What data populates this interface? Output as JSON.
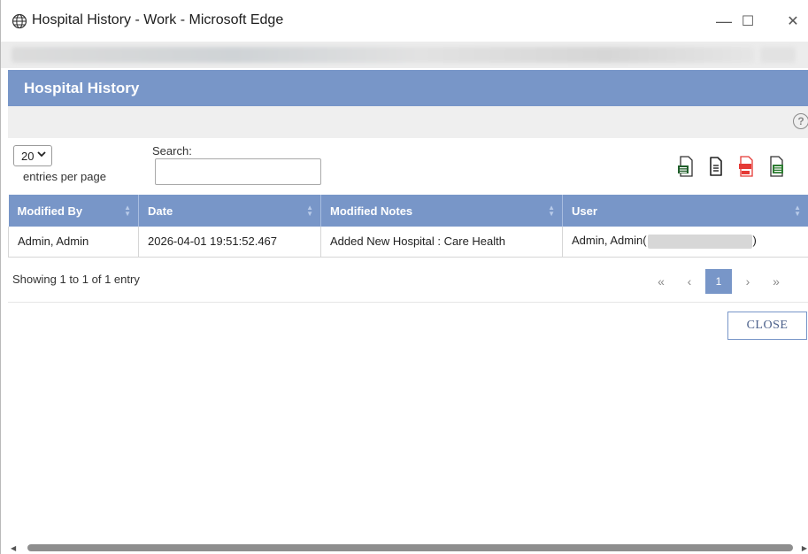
{
  "window": {
    "title": "Hospital History - Work - Microsoft Edge",
    "minimize": "—",
    "maximize": "☐",
    "close": "✕"
  },
  "dialog": {
    "title": "Hospital History",
    "help": "?"
  },
  "controls": {
    "page_size": "20",
    "entries_label": "entries per page",
    "search_label": "Search:",
    "search_value": ""
  },
  "table": {
    "columns": [
      "Modified By",
      "Date",
      "Modified Notes",
      "User"
    ],
    "rows": [
      {
        "modified_by": "Admin, Admin",
        "date": "2026-04-01 19:51:52.467",
        "notes": "Added New Hospital : Care Health",
        "user_prefix": "Admin, Admin(",
        "user_suffix": ")"
      }
    ]
  },
  "footer": {
    "showing": "Showing 1 to 1 of 1 entry",
    "pager": {
      "first": "«",
      "prev": "‹",
      "current": "1",
      "next": "›",
      "last": "»"
    },
    "close_label": "CLOSE"
  },
  "colors": {
    "accent": "#7896c8",
    "pdf": "#e53935",
    "excel": "#2e7d32"
  },
  "icons": [
    "globe-icon",
    "csv-icon",
    "copy-icon",
    "pdf-icon",
    "excel-icon",
    "help-icon"
  ]
}
